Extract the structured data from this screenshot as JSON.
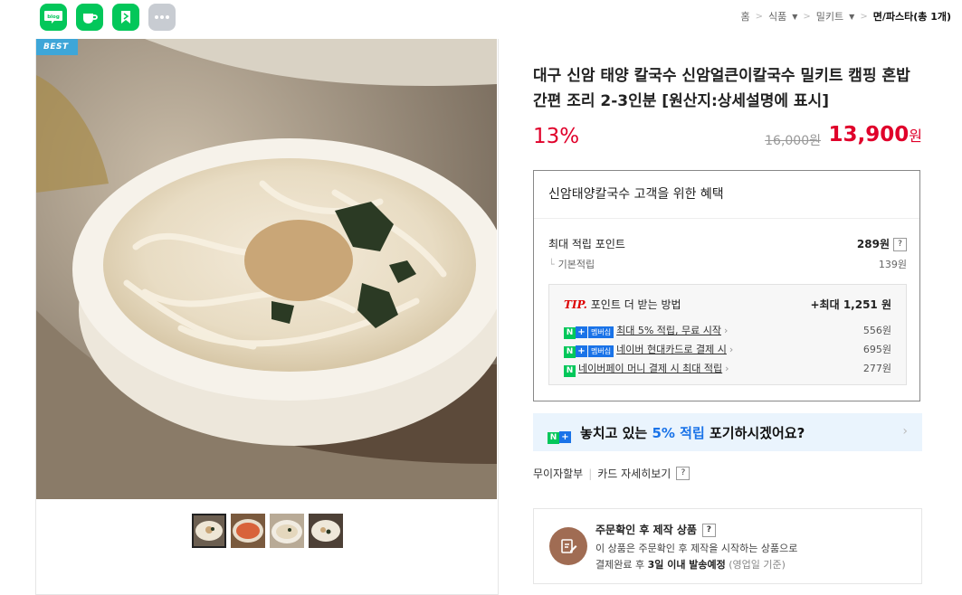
{
  "share": {
    "icons": [
      {
        "name": "blog-share-icon",
        "label": "blog",
        "color": "#03c75a"
      },
      {
        "name": "cafe-share-icon",
        "color": "#03c75a"
      },
      {
        "name": "bookmark-share-icon",
        "color": "#03c75a"
      },
      {
        "name": "more-share-icon",
        "color": "#c8ccd2"
      }
    ]
  },
  "breadcrumb": {
    "home": "홈",
    "level1": "식품",
    "level2": "밀키트",
    "current": "면/파스타(총 1개)"
  },
  "gallery": {
    "badge": "BEST",
    "thumbnails": [
      "thumb-1",
      "thumb-2",
      "thumb-3",
      "thumb-4"
    ]
  },
  "product": {
    "title": "대구 신암 태양 칼국수 신암얼큰이칼국수 밀키트 캠핑 혼밥 간편 조리 2-3인분 [원산지:상세설명에 표시]",
    "discount": "13%",
    "original_price": "16,000원",
    "sale_price": "13,900",
    "sale_unit": "원"
  },
  "benefit": {
    "heading": "신암태양칼국수 고객을 위한 혜택",
    "max_points_label": "최대 적립 포인트",
    "max_points_value": "289원",
    "base_label": "기본적립",
    "base_value": "139원",
    "tip_label": "TIP.",
    "tip_text": "포인트 더 받는 방법",
    "tip_max": "+최대 1,251 원",
    "items": [
      {
        "badge": "멤버십",
        "text": "최대 5% 적립, 무료 시작",
        "amount": "556원"
      },
      {
        "badge": "멤버십",
        "text": "네이버 현대카드로 결제 시",
        "amount": "695원"
      },
      {
        "badge": "",
        "text": "네이버페이 머니 결제 시 최대 적립",
        "amount": "277원"
      }
    ]
  },
  "promo": {
    "prefix": "놓치고 있는 ",
    "highlight": "5% 적립",
    "suffix": " 포기하시겠어요?",
    "accent": "#1a73e8"
  },
  "links": {
    "installment": "무이자할부",
    "card_detail": "카드 자세히보기"
  },
  "order": {
    "title": "주문확인 후 제작 상품",
    "desc1": "이 상품은 주문확인 후 제작을 시작하는 상품으로",
    "desc2_prefix": "결제완료 후 ",
    "desc2_bold": "3일 이내 발송예정",
    "desc2_suffix": " (영업일 기준)"
  },
  "help": "?"
}
